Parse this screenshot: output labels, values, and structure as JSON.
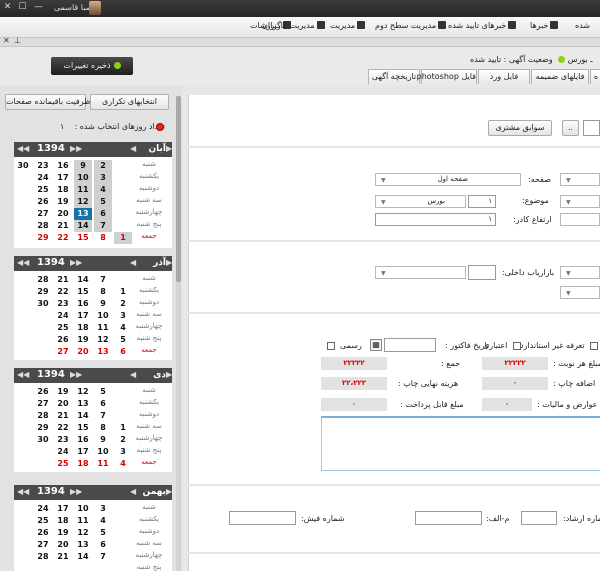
{
  "topbar": {
    "username": "صبا قاسمی",
    "minimize": "—",
    "restore": "☐",
    "close": "✕"
  },
  "menubar": {
    "items": [
      {
        "label": "شده",
        "icon": "none"
      },
      {
        "label": "خبرها",
        "icon": "news-icon"
      },
      {
        "label": "خبرهای تایید شده",
        "icon": "checkmark-icon"
      },
      {
        "label": "مدیریت سطح دوم",
        "icon": "gears-icon"
      },
      {
        "label": "مدیریت",
        "icon": "gear-icon"
      },
      {
        "label": "مدیریت کاربران",
        "icon": "user-icon"
      },
      {
        "label": "گزارشات",
        "icon": "report-icon"
      }
    ]
  },
  "strip": {
    "close": "✕",
    "pin": "⊥"
  },
  "status": {
    "text": "وضعیت آگهی : تایید شده",
    "prefix": "ـ بورس"
  },
  "toolbar": {
    "save_label": "ذخیره تغییرات"
  },
  "tabs": [
    "فایلهای ضمیمه",
    "فایل ورد",
    "فایل photoshop",
    "تاریخچه آگهی",
    "ه"
  ],
  "left": {
    "ask_capacity": "ظرفیت باقیمانده صفحات",
    "repeat_select": "انتخابهای تکراری",
    "selected_days_label": "تعداد روزهای انتخاب شده :",
    "selected_days_count": "۱"
  },
  "weekdays": [
    "شنبه",
    "یکشنبه",
    "دوشنبه",
    "سه شنبه",
    "چهارشنبه",
    "پنج شنبه",
    "جمعه"
  ],
  "calendars": [
    {
      "month": "آبان",
      "year": "1394",
      "rows": [
        [
          "",
          "",
          "",
          "9",
          "2"
        ],
        [
          "",
          "",
          "17",
          "10",
          "3"
        ],
        [
          "",
          "",
          "18",
          "11",
          "4"
        ],
        [
          "",
          "",
          "19",
          "12",
          "5"
        ],
        [
          "",
          "",
          "20",
          "13",
          "6"
        ],
        [
          "",
          "",
          "21",
          "14",
          "7"
        ],
        [
          "",
          "",
          "22",
          "15",
          "8",
          "1"
        ]
      ],
      "extra": [
        "30",
        "23",
        "16",
        "24",
        "25",
        "26",
        "27",
        "28",
        "29"
      ]
    },
    {
      "month": "آذر",
      "year": "1394"
    },
    {
      "month": "دی",
      "year": "1394"
    },
    {
      "month": "بهمن",
      "year": "1394"
    }
  ],
  "form": {
    "customer_history": "سوابق مشتری",
    "ellipsis": "..",
    "page_label": "صفحه:",
    "page_value": "صفحه اول",
    "topic_label": "موضوع:",
    "topic_number": "۱",
    "topic_value": "بورس",
    "frame_height_label": "ارتفاع کادر:",
    "frame_height_value": "۱",
    "internal_marketer_label": "بازاریاب داخلی:",
    "non_standard_tariff": "تعرفه غیر استاندارد",
    "credit": "اعتباری",
    "invoice_date": "تاریخ فاکتور :",
    "official": "رسمی",
    "amount_per_turn": "مبلغ هر نوبت :",
    "amount_per_turn_value": "۲۲۲۲۲",
    "sum_label": "جمع :",
    "sum_value": "۲۲۲۲۲",
    "print_surcharge": "اضافه چاپ :",
    "print_surcharge_value": "۰",
    "final_print_cost": "هزینه نهایی چاپ :",
    "final_print_cost_value": "۲۲،۲۲۲",
    "taxes": "عوارض و مالیات :",
    "taxes_value": "۰",
    "payable": "مبلغ قابل پرداخت :",
    "payable_value": "۰",
    "referral_number": "شماره ارشاد:",
    "mf_label": "م-الف:",
    "receipt_number": "شماره فیش:"
  }
}
